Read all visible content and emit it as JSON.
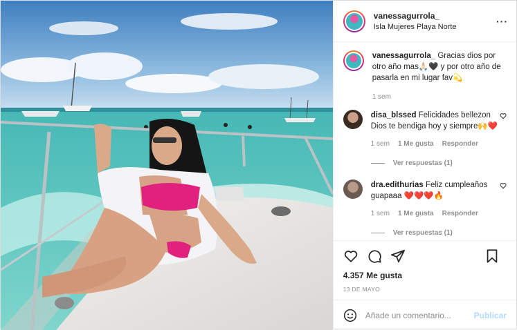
{
  "post": {
    "username": "vanessagurrola_",
    "location": "Isla Mujeres Playa Norte"
  },
  "caption": {
    "username": "vanessagurrola_",
    "text": "Gracias dios por otro año mas🙏🏻🖤 y por otro año de pasarla en mi lugar fav💫",
    "time": "1 sem"
  },
  "comments": [
    {
      "username": "disa_blssed",
      "text": "Felicidades bellezon Dios te bendiga hoy y siempre🙌❤️",
      "time": "1 sem",
      "likes": "1 Me gusta",
      "reply": "Responder",
      "view_replies": "Ver respuestas (1)"
    },
    {
      "username": "dra.edithurias",
      "text": "Feliz cumpleaños guapaaa ❤️❤️❤️🔥",
      "time": "1 sem",
      "likes": "1 Me gusta",
      "reply": "Responder",
      "view_replies": "Ver respuestas (1)"
    }
  ],
  "stats": {
    "likes": "4.357 Me gusta",
    "date": "13 DE MAYO"
  },
  "composer": {
    "placeholder": "Añade un comentario...",
    "publish": "Publicar"
  },
  "icons": {
    "like": "heart-outline-icon",
    "comment": "comment-bubble-icon",
    "share": "paper-plane-icon",
    "save": "bookmark-icon",
    "emoji": "smiley-icon",
    "more": "more-dots-icon"
  },
  "colors": {
    "publish_disabled": "#b3dbff",
    "meta_gray": "#8e8e8e",
    "text": "#262626"
  }
}
